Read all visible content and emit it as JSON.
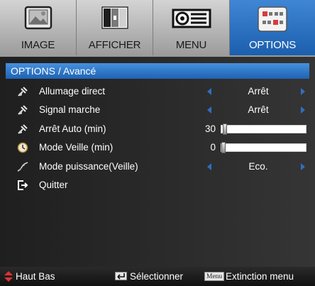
{
  "tabs": [
    {
      "label": "IMAGE",
      "icon": "image-icon",
      "active": false
    },
    {
      "label": "AFFICHER",
      "icon": "display-icon",
      "active": false
    },
    {
      "label": "MENU",
      "icon": "projector-icon",
      "active": false
    },
    {
      "label": "OPTIONS",
      "icon": "options-icon",
      "active": true
    }
  ],
  "panel": {
    "title": "OPTIONS / Avancé",
    "rows": [
      {
        "label": "Allumage direct",
        "icon": "setup-icon",
        "value": "Arrêt"
      },
      {
        "label": "Signal marche",
        "icon": "setup-icon",
        "value": "Arrêt"
      },
      {
        "label": "Arrêt Auto (min)",
        "icon": "setup-icon",
        "number": "30",
        "slider_fraction": 0.02
      },
      {
        "label": "Mode Veille (min)",
        "icon": "clock-icon",
        "number": "0",
        "slider_fraction": 0.0
      },
      {
        "label": "Mode puissance(Veille)",
        "icon": "power-mode-icon",
        "value": "Eco."
      },
      {
        "label": "Quitter",
        "icon": "exit-icon"
      }
    ]
  },
  "help": {
    "navigate": "Haut Bas",
    "select": "Sélectionner",
    "menu_key": "Menu",
    "exit": "Extinction menu"
  },
  "colors": {
    "accent": "#1f63b4",
    "arrow": "#2f6fc2"
  }
}
